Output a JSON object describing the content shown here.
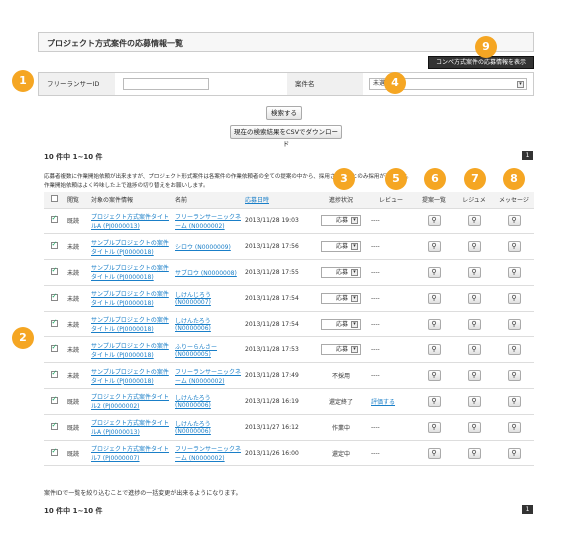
{
  "page_title": "プロジェクト方式案件の応募情報一覧",
  "csv_compe_button": "コンペ方式案件の応募情報を表示",
  "search": {
    "freelancer_label": "フリーランサーID",
    "project_label": "案件名",
    "project_select_value": "未選",
    "search_button": "検索する",
    "csv_button": "現在の検索結果をCSVでダウンロード"
  },
  "count_top": "10 件中 1~10 件",
  "count_bottom": "10 件中 1~10 件",
  "page_number": "1",
  "notice_line1": "応募者複数に作業開始依頼が出来ますが、プロジェクト形式案件は各案件の作業依頼者の全ての提案の中から、採用されることのみ採用が可能です。",
  "notice_line2": "作業開始依頼はよく吟味した上で進捗の切り替えをお願いします。",
  "footer_note": "案件IDで一覧を絞り込むことで進捗の一括変更が出来るようになります。",
  "badges": [
    "1",
    "2",
    "3",
    "4",
    "5",
    "6",
    "7",
    "8",
    "9"
  ],
  "table": {
    "headers": [
      "",
      "閲覧",
      "対象の案件情報",
      "名前",
      "応募日時",
      "進捗状況",
      "レビュー",
      "提案一覧",
      "レジュメ",
      "メッセージ"
    ],
    "rows": [
      {
        "checked": true,
        "read": "既読",
        "project": "プロジェクト方式案件タイトルA (PJ0000013)",
        "name": "フリーランサーニックネーム (N0000002)",
        "date": "2013/11/28 19:03",
        "status": "応募",
        "status_type": "select",
        "review": "----"
      },
      {
        "checked": true,
        "read": "未読",
        "project": "サンプルプロジェクトの案件タイトル (PJ0000018)",
        "name": "シロウ (N0000009)",
        "date": "2013/11/28 17:56",
        "status": "応募",
        "status_type": "select",
        "review": "----"
      },
      {
        "checked": true,
        "read": "未読",
        "project": "サンプルプロジェクトの案件タイトル (PJ0000018)",
        "name": "サブロウ (N0000008)",
        "date": "2013/11/28 17:55",
        "status": "応募",
        "status_type": "select",
        "review": "----"
      },
      {
        "checked": true,
        "read": "未読",
        "project": "サンプルプロジェクトの案件タイトル (PJ0000018)",
        "name": "しけんじろう (N0000007)",
        "date": "2013/11/28 17:54",
        "status": "応募",
        "status_type": "select",
        "review": "----"
      },
      {
        "checked": true,
        "read": "未読",
        "project": "サンプルプロジェクトの案件タイトル (PJ0000018)",
        "name": "しけんたろう (N0000006)",
        "date": "2013/11/28 17:54",
        "status": "応募",
        "status_type": "select",
        "review": "----"
      },
      {
        "checked": true,
        "read": "未読",
        "project": "サンプルプロジェクトの案件タイトル (PJ0000018)",
        "name": "ふりーらんさー (N0000005)",
        "date": "2013/11/28 17:53",
        "status": "応募",
        "status_type": "select",
        "review": "----"
      },
      {
        "checked": true,
        "read": "未読",
        "project": "サンプルプロジェクトの案件タイトル (PJ0000018)",
        "name": "フリーランサーニックネーム (N0000002)",
        "date": "2013/11/28 17:49",
        "status": "不採用",
        "status_type": "text",
        "review": "----"
      },
      {
        "checked": true,
        "read": "既読",
        "project": "プロジェクト方式案件タイトル2 (PJ0000002)",
        "name": "しけんたろう (N0000006)",
        "date": "2013/11/28 16:19",
        "status": "還定終了",
        "status_type": "text",
        "review": "評価する"
      },
      {
        "checked": true,
        "read": "既読",
        "project": "プロジェクト方式案件タイトルA (PJ0000013)",
        "name": "しけんたろう (N0000006)",
        "date": "2013/11/27 16:12",
        "status": "作業中",
        "status_type": "text",
        "review": "----"
      },
      {
        "checked": true,
        "read": "既読",
        "project": "プロジェクト方式案件タイトル7 (PJ0000007)",
        "name": "フリーランサーニックネーム (N0000002)",
        "date": "2013/11/26 16:00",
        "status": "還定中",
        "status_type": "text",
        "review": "----"
      }
    ]
  },
  "colors": {
    "badge": "#f5a623",
    "link": "#1a7fc8",
    "header_bg": "#f3f3f3"
  },
  "icons": {
    "magnifier": "search-icon",
    "dropdown": "chevron-down-icon"
  }
}
